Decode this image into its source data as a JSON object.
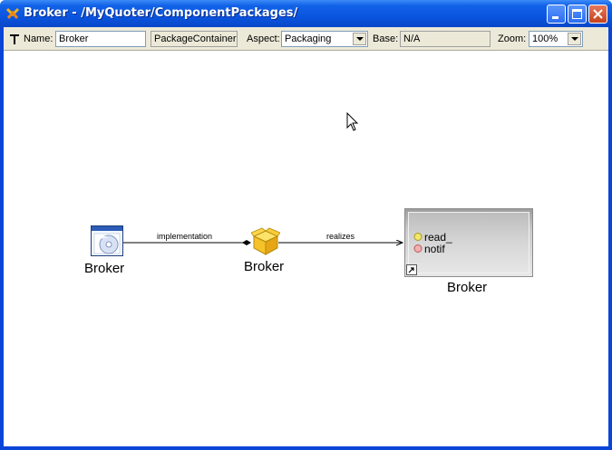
{
  "window": {
    "title": "Broker - /MyQuoter/ComponentPackages/"
  },
  "toolbar": {
    "name_label": "Name:",
    "name_value": "Broker",
    "kind_value": "PackageContainer",
    "aspect_label": "Aspect:",
    "aspect_value": "Packaging",
    "base_label": "Base:",
    "base_value": "N/A",
    "zoom_label": "Zoom:",
    "zoom_value": "100%"
  },
  "diagram": {
    "nodes": [
      {
        "id": "implementation-node",
        "label": "Broker",
        "icon": "component-implementation-icon"
      },
      {
        "id": "package-node",
        "label": "Broker",
        "icon": "package-box-icon"
      },
      {
        "id": "component-node",
        "label": "Broker",
        "icon": "component-box",
        "ports": [
          "read_",
          "notif"
        ]
      }
    ],
    "edges": [
      {
        "label": "implementation"
      },
      {
        "label": "realizes"
      }
    ]
  }
}
